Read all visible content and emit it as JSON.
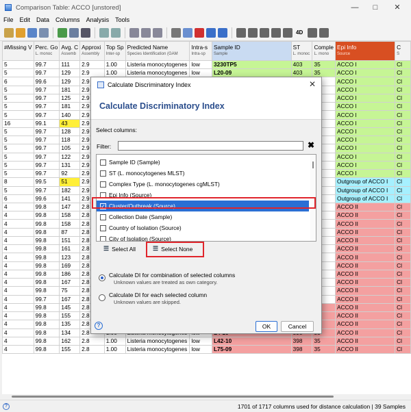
{
  "window": {
    "title": "Comparison Table: ACCO [unstored]"
  },
  "menu": [
    "File",
    "Edit",
    "Data",
    "Columns",
    "Analysis",
    "Tools"
  ],
  "toolbar": {
    "label_4d": "4D"
  },
  "table": {
    "columns": [
      {
        "name": "#Missing V",
        "sub": ""
      },
      {
        "name": "Perc. Go",
        "sub": "L. monoc"
      },
      {
        "name": "Avg. C",
        "sub": "Assemb"
      },
      {
        "name": "Approxi",
        "sub": "Assembly"
      },
      {
        "name": "Top Sp",
        "sub": "Inter-sp"
      },
      {
        "name": "Predicted Name",
        "sub": "Species Identification (GAM"
      },
      {
        "name": "Intra-s",
        "sub": "Intra-sp"
      },
      {
        "name": "Sample ID",
        "sub": "Sample"
      },
      {
        "name": "ST",
        "sub": "L. monoc"
      },
      {
        "name": "Comple",
        "sub": "L. mono"
      },
      {
        "name": "Epi Info",
        "sub": "Source"
      },
      {
        "name": "C",
        "sub": "S"
      }
    ],
    "rows": [
      [
        "5",
        "99.7",
        "111",
        "2.9",
        "1.00",
        "Listeria monocytogenes",
        "low",
        "3230TP5",
        "403",
        "35",
        "ACCO I",
        "Cl"
      ],
      [
        "5",
        "99.7",
        "129",
        "2.9",
        "1.00",
        "Listeria monocytogenes",
        "low",
        "L20-09",
        "403",
        "35",
        "ACCO I",
        "Cl"
      ],
      [
        "6",
        "99.6",
        "129",
        "2.9",
        "",
        "",
        "",
        "",
        "",
        "",
        "ACCO I",
        "Cl"
      ],
      [
        "5",
        "99.7",
        "181",
        "2.9",
        "",
        "",
        "",
        "",
        "",
        "",
        "ACCO I",
        "Cl"
      ],
      [
        "5",
        "99.7",
        "125",
        "2.9",
        "",
        "",
        "",
        "",
        "",
        "",
        "ACCO I",
        "Cl"
      ],
      [
        "5",
        "99.7",
        "181",
        "2.9",
        "",
        "",
        "",
        "",
        "",
        "",
        "ACCO I",
        "Cl"
      ],
      [
        "5",
        "99.7",
        "140",
        "2.9",
        "",
        "",
        "",
        "",
        "",
        "",
        "ACCO I",
        "Cl"
      ],
      [
        "16",
        "99.1",
        "43",
        "2.9",
        "",
        "",
        "",
        "",
        "",
        "",
        "ACCO I",
        "Cl"
      ],
      [
        "5",
        "99.7",
        "128",
        "2.9",
        "",
        "",
        "",
        "",
        "",
        "",
        "ACCO I",
        "Cl"
      ],
      [
        "5",
        "99.7",
        "118",
        "2.9",
        "",
        "",
        "",
        "",
        "",
        "",
        "ACCO I",
        "Cl"
      ],
      [
        "5",
        "99.7",
        "105",
        "2.9",
        "",
        "",
        "",
        "",
        "",
        "",
        "ACCO I",
        "Cl"
      ],
      [
        "5",
        "99.7",
        "122",
        "2.9",
        "",
        "",
        "",
        "",
        "",
        "",
        "ACCO I",
        "Cl"
      ],
      [
        "5",
        "99.7",
        "131",
        "2.9",
        "",
        "",
        "",
        "",
        "",
        "",
        "ACCO I",
        "Cl"
      ],
      [
        "5",
        "99.7",
        "92",
        "2.9",
        "",
        "",
        "",
        "",
        "",
        "",
        "ACCO I",
        "Cl"
      ],
      [
        "8",
        "99.5",
        "51",
        "2.9",
        "",
        "",
        "",
        "",
        "",
        "",
        "Outgroup of ACCO I",
        "Cl"
      ],
      [
        "5",
        "99.7",
        "182",
        "2.9",
        "",
        "",
        "",
        "",
        "",
        "",
        "Outgroup of ACCO I",
        "Cl"
      ],
      [
        "6",
        "99.6",
        "141",
        "2.9",
        "",
        "",
        "",
        "",
        "",
        "",
        "Outgroup of ACCO I",
        "Cl"
      ],
      [
        "4",
        "99.8",
        "147",
        "2.8",
        "",
        "",
        "",
        "",
        "",
        "",
        "ACCO II",
        "Cl"
      ],
      [
        "4",
        "99.8",
        "158",
        "2.8",
        "",
        "",
        "",
        "",
        "",
        "",
        "ACCO II",
        "Cl"
      ],
      [
        "4",
        "99.8",
        "158",
        "2.8",
        "",
        "",
        "",
        "",
        "",
        "",
        "ACCO II",
        "Cl"
      ],
      [
        "4",
        "99.8",
        "87",
        "2.8",
        "",
        "",
        "",
        "",
        "",
        "",
        "ACCO II",
        "Cl"
      ],
      [
        "4",
        "99.8",
        "151",
        "2.8",
        "",
        "",
        "",
        "",
        "",
        "",
        "ACCO II",
        "Cl"
      ],
      [
        "4",
        "99.8",
        "161",
        "2.8",
        "",
        "",
        "",
        "",
        "",
        "",
        "ACCO II",
        "Cl"
      ],
      [
        "4",
        "99.8",
        "123",
        "2.8",
        "",
        "",
        "",
        "",
        "",
        "",
        "ACCO II",
        "Cl"
      ],
      [
        "4",
        "99.8",
        "169",
        "2.8",
        "",
        "",
        "",
        "",
        "",
        "",
        "ACCO II",
        "Cl"
      ],
      [
        "4",
        "99.8",
        "186",
        "2.8",
        "",
        "",
        "",
        "",
        "",
        "",
        "ACCO II",
        "Cl"
      ],
      [
        "4",
        "99.8",
        "167",
        "2.8",
        "",
        "",
        "",
        "",
        "",
        "",
        "ACCO II",
        "Cl"
      ],
      [
        "4",
        "99.8",
        "75",
        "2.8",
        "",
        "",
        "",
        "",
        "",
        "",
        "ACCO II",
        "Cl"
      ],
      [
        "4",
        "99.7",
        "167",
        "2.8",
        "",
        "",
        "",
        "",
        "",
        "",
        "ACCO II",
        "Cl"
      ],
      [
        "4",
        "99.8",
        "145",
        "2.8",
        "1.00",
        "Listeria monocytogenes",
        "low",
        "L30-10",
        "398",
        "35",
        "ACCO II",
        "Cl"
      ],
      [
        "4",
        "99.8",
        "155",
        "2.8",
        "1.00",
        "Listeria monocytogenes",
        "low",
        "L32-10",
        "398",
        "35",
        "ACCO II",
        "Cl"
      ],
      [
        "4",
        "99.8",
        "135",
        "2.8",
        "1.00",
        "Listeria monocytogenes",
        "low",
        "L33-10",
        "398",
        "35",
        "ACCO II",
        "Cl"
      ],
      [
        "4",
        "99.8",
        "134",
        "2.8",
        "1.00",
        "Listeria monocytogenes",
        "low",
        "L4-10",
        "398",
        "35",
        "ACCO II",
        "Cl"
      ],
      [
        "4",
        "99.8",
        "162",
        "2.8",
        "1.00",
        "Listeria monocytogenes",
        "low",
        "L42-10",
        "398",
        "35",
        "ACCO II",
        "Cl"
      ],
      [
        "4",
        "99.8",
        "155",
        "2.8",
        "1.00",
        "Listeria monocytogenes",
        "low",
        "L75-09",
        "398",
        "35",
        "ACCO II",
        "Cl"
      ]
    ],
    "highlight": {
      "yellow_rows": [
        7,
        14
      ],
      "green_rows": [
        0,
        1
      ],
      "cyan_rows": [
        14,
        15,
        16
      ]
    },
    "colors": {
      "epi_header": "#d84f22",
      "acco1": "#c6f595",
      "acco2": "#f4a0a0",
      "outgroup": "#a6f0ff",
      "yellow": "#ffef38"
    }
  },
  "status": {
    "text": "1701 of 1717 columns used for distance calculation",
    "samples": "39 Samples"
  },
  "dialog": {
    "title": "Calculate Discriminatory Index",
    "heading": "Calculate Discriminatory Index",
    "select_label": "Select columns:",
    "filter_label": "Filter:",
    "items": [
      {
        "label": "Sample ID (Sample)",
        "checked": false
      },
      {
        "label": "ST (L. monocytogenes MLST)",
        "checked": false
      },
      {
        "label": "Complex Type (L. monocytogenes cgMLST)",
        "checked": false
      },
      {
        "label": "Epi Info (Source)",
        "checked": false
      },
      {
        "label": "Cluster/Outbreak (Source)",
        "checked": true,
        "selected": true
      },
      {
        "label": "Collection Date (Sample)",
        "checked": false
      },
      {
        "label": "Country of Isolation (Source)",
        "checked": false
      },
      {
        "label": "City of Isolation (Source)",
        "checked": false
      }
    ],
    "select_all": "Select All",
    "select_none": "Select None",
    "option1": "Calculate DI for combination of selected columns",
    "option1_hint": "Unknown values are treated as own category.",
    "option2": "Calculate DI for each selected column",
    "option2_hint": "Unknown values are skipped.",
    "ok": "OK",
    "cancel": "Cancel"
  }
}
